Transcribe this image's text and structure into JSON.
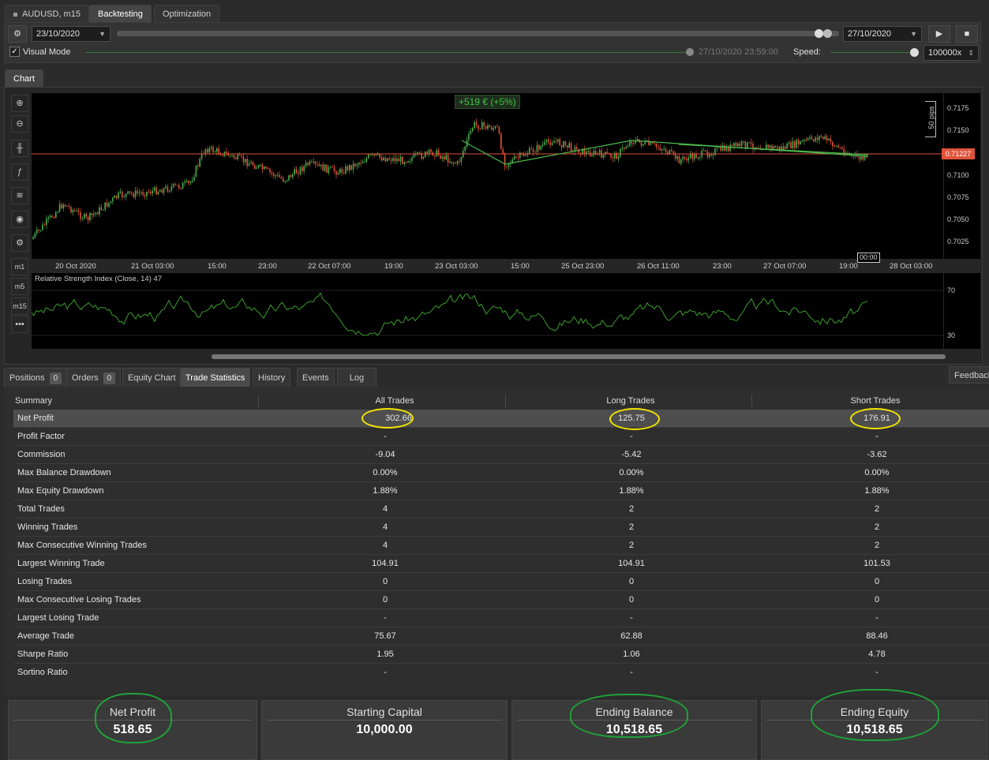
{
  "top_tabs": {
    "symbol": "AUDUSD, m15",
    "backtesting": "Backtesting",
    "optimization": "Optimization"
  },
  "controls": {
    "start_date": "23/10/2020",
    "end_date": "27/10/2020",
    "visual_mode_label": "Visual Mode",
    "visual_mode_checked": true,
    "current_time": "27/10/2020 23:59:00",
    "speed_label": "Speed:",
    "speed_value": "100000x"
  },
  "chart_tab": "Chart",
  "chart": {
    "profit_label": "+519 € (+5%)",
    "pips_label": "50 pips",
    "current_price": "0.71227",
    "price_ticks": [
      "0.7175",
      "0.7150",
      "0.7125",
      "0.7100",
      "0.7075",
      "0.7050",
      "0.7025"
    ],
    "time_ticks": [
      "20 Oct 2020",
      "21 Oct 03:00",
      "15:00",
      "23:00",
      "22 Oct 07:00",
      "19:00",
      "23 Oct 03:00",
      "15:00",
      "25 Oct 23:00",
      "26 Oct 11:00",
      "23:00",
      "27 Oct 07:00",
      "19:00",
      "28 Oct 03:00"
    ],
    "time_marker": "00:00",
    "rsi_label": "Relative Strength Index (Close, 14) 47",
    "rsi_ticks": [
      "70",
      "30"
    ],
    "timeframe_buttons": [
      "m1",
      "m5",
      "m15"
    ],
    "colors": {
      "bull": "#4caf50",
      "bear": "#e0533a",
      "price_line": "#e0533a",
      "rsi": "#3fae2e"
    }
  },
  "bottom_tabs": [
    {
      "label": "Positions",
      "badge": "0"
    },
    {
      "label": "Orders",
      "badge": "0"
    },
    {
      "label": "Equity Chart"
    },
    {
      "label": "Trade Statistics"
    },
    {
      "label": "History"
    },
    {
      "label": "Events"
    },
    {
      "label": "Log"
    }
  ],
  "feedback": "Feedback",
  "stats": {
    "headers": [
      "Summary",
      "All Trades",
      "Long Trades",
      "Short Trades"
    ],
    "rows": [
      {
        "label": "Net Profit",
        "all": "302.66",
        "long": "125.75",
        "short": "176.91"
      },
      {
        "label": "Profit Factor",
        "all": "-",
        "long": "-",
        "short": "-"
      },
      {
        "label": "Commission",
        "all": "-9.04",
        "long": "-5.42",
        "short": "-3.62"
      },
      {
        "label": "Max Balance Drawdown",
        "all": "0.00%",
        "long": "0.00%",
        "short": "0.00%"
      },
      {
        "label": "Max Equity Drawdown",
        "all": "1.88%",
        "long": "1.88%",
        "short": "1.88%"
      },
      {
        "label": "Total Trades",
        "all": "4",
        "long": "2",
        "short": "2"
      },
      {
        "label": "Winning Trades",
        "all": "4",
        "long": "2",
        "short": "2"
      },
      {
        "label": "Max Consecutive Winning Trades",
        "all": "4",
        "long": "2",
        "short": "2"
      },
      {
        "label": "Largest Winning Trade",
        "all": "104.91",
        "long": "104.91",
        "short": "101.53"
      },
      {
        "label": "Losing Trades",
        "all": "0",
        "long": "0",
        "short": "0"
      },
      {
        "label": "Max Consecutive Losing Trades",
        "all": "0",
        "long": "0",
        "short": "0"
      },
      {
        "label": "Largest Losing Trade",
        "all": "-",
        "long": "-",
        "short": "-"
      },
      {
        "label": "Average Trade",
        "all": "75.67",
        "long": "62.88",
        "short": "88.46"
      },
      {
        "label": "Sharpe Ratio",
        "all": "1.95",
        "long": "1.06",
        "short": "4.78"
      },
      {
        "label": "Sortino Ratio",
        "all": "-",
        "long": "-",
        "short": "-"
      }
    ]
  },
  "summary_cards": [
    {
      "title": "Net Profit",
      "value": "518.65"
    },
    {
      "title": "Starting Capital",
      "value": "10,000.00"
    },
    {
      "title": "Ending Balance",
      "value": "10,518.65"
    },
    {
      "title": "Ending Equity",
      "value": "10,518.65"
    }
  ]
}
